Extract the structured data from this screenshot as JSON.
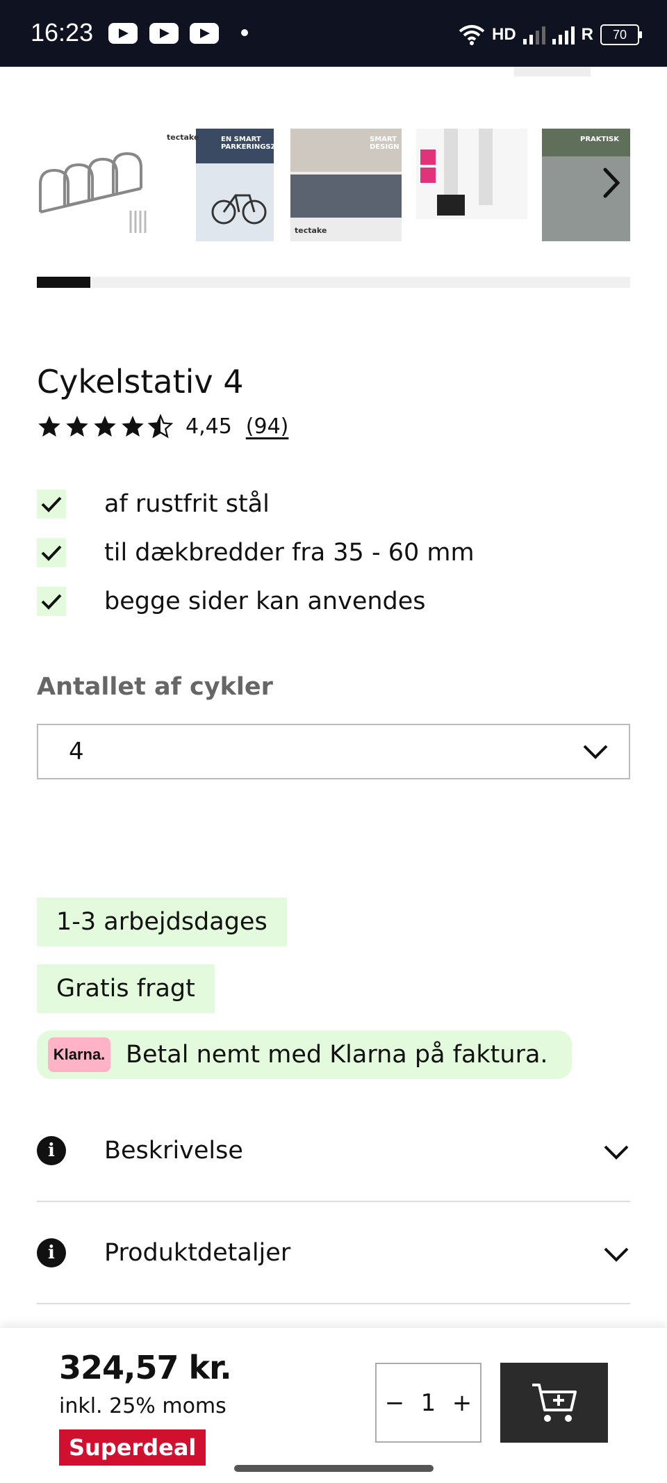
{
  "status_bar": {
    "time": "16:23",
    "network": "HD",
    "carrier": "R",
    "battery": "70"
  },
  "gallery": {
    "thumbnails": [
      {
        "icon": "bike-rack-image"
      },
      {
        "icon": "promo-image",
        "heading": "EN SMART PARKERINGSZONE",
        "brand": "tectake"
      },
      {
        "icon": "design-image",
        "heading": "SMART DESIGN",
        "brand": "tectake"
      },
      {
        "icon": "detail-image"
      },
      {
        "icon": "practical-image",
        "heading": "PRAKTISK"
      }
    ],
    "progress": 0.09
  },
  "product": {
    "title": "Cykelstativ 4",
    "rating": 4.45,
    "rating_text": "4,45",
    "review_count": "(94)",
    "features": [
      "af rustfrit stål",
      "til dækbredder fra 35 - 60 mm",
      "begge sider kan anvendes"
    ],
    "option_label": "Antallet af cykler",
    "option_value": "4"
  },
  "delivery": {
    "time": "1-3 arbejdsdages",
    "shipping": "Gratis fragt",
    "klarna_logo": "Klarna.",
    "klarna_text": "Betal nemt med Klarna på faktura."
  },
  "accordions": [
    {
      "label": "Beskrivelse",
      "icon": "info-icon"
    },
    {
      "label": "Produktdetaljer",
      "icon": "info-icon"
    }
  ],
  "buy_bar": {
    "price": "324,57 kr.",
    "vat": "inkl. 25% moms",
    "badge": "Superdeal",
    "quantity": "1",
    "minus": "−",
    "plus": "+"
  },
  "colors": {
    "accent_green": "#e3fbdc",
    "badge_red": "#d0102e",
    "cart_button": "#2b2b2b",
    "klarna_pink": "#ffb3c7"
  }
}
